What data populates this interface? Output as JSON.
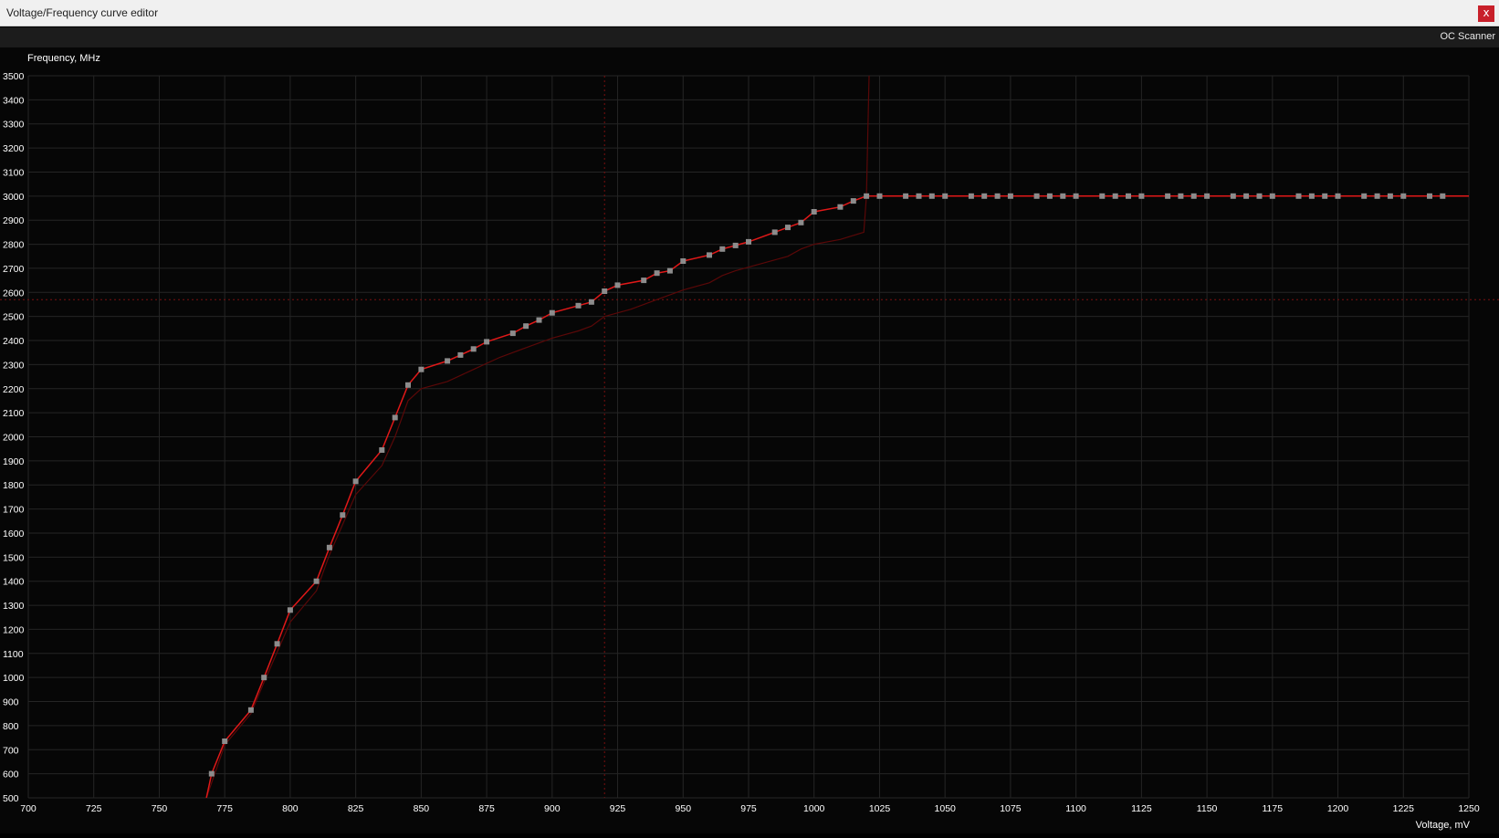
{
  "window": {
    "title": "Voltage/Frequency curve editor",
    "close_label": "x"
  },
  "toolbar": {
    "oc_scanner_label": "OC Scanner"
  },
  "colors": {
    "curve": "#e01818",
    "curve_dim": "#5a0808",
    "point": "#8c8c8c",
    "grid": "#252525",
    "crosshair": "#7a1010",
    "background": "#060606",
    "text": "#ffffff"
  },
  "chart_data": {
    "type": "line",
    "title": "",
    "xlabel": "Voltage, mV",
    "ylabel": "Frequency, MHz",
    "xlim": [
      700,
      1250
    ],
    "ylim": [
      500,
      3500
    ],
    "x_ticks": [
      700,
      725,
      750,
      775,
      800,
      825,
      850,
      875,
      900,
      925,
      950,
      975,
      1000,
      1025,
      1050,
      1075,
      1100,
      1125,
      1150,
      1175,
      1200,
      1225,
      1250
    ],
    "y_ticks": [
      500,
      600,
      700,
      800,
      900,
      1000,
      1100,
      1200,
      1300,
      1400,
      1500,
      1600,
      1700,
      1800,
      1900,
      2000,
      2100,
      2200,
      2300,
      2400,
      2500,
      2600,
      2700,
      2800,
      2900,
      3000,
      3100,
      3200,
      3300,
      3400,
      3500
    ],
    "crosshair": {
      "x": 920,
      "y": 2570
    },
    "series": [
      {
        "role": "edited",
        "x": [
          768,
          770,
          775,
          785,
          790,
          795,
          800,
          810,
          815,
          820,
          825,
          835,
          840,
          845,
          850,
          860,
          865,
          870,
          875,
          885,
          890,
          895,
          900,
          910,
          915,
          920,
          925,
          935,
          940,
          945,
          950,
          960,
          965,
          970,
          975,
          985,
          990,
          995,
          1000,
          1010,
          1015,
          1020,
          1025,
          1035,
          1040,
          1045,
          1050,
          1060,
          1065,
          1070,
          1075,
          1085,
          1090,
          1095,
          1100,
          1110,
          1115,
          1120,
          1125,
          1135,
          1140,
          1145,
          1150,
          1160,
          1165,
          1170,
          1175,
          1185,
          1190,
          1195,
          1200,
          1210,
          1215,
          1220,
          1225,
          1235,
          1240,
          1250
        ],
        "y": [
          500,
          600,
          735,
          865,
          1000,
          1140,
          1280,
          1400,
          1540,
          1675,
          1815,
          1945,
          2080,
          2215,
          2280,
          2315,
          2340,
          2365,
          2395,
          2430,
          2460,
          2485,
          2515,
          2545,
          2560,
          2605,
          2630,
          2650,
          2680,
          2690,
          2730,
          2755,
          2780,
          2795,
          2810,
          2850,
          2870,
          2890,
          2935,
          2955,
          2980,
          3000,
          3000,
          3000,
          3000,
          3000,
          3000,
          3000,
          3000,
          3000,
          3000,
          3000,
          3000,
          3000,
          3000,
          3000,
          3000,
          3000,
          3000,
          3000,
          3000,
          3000,
          3000,
          3000,
          3000,
          3000,
          3000,
          3000,
          3000,
          3000,
          3000,
          3000,
          3000,
          3000,
          3000,
          3000,
          3000,
          3000
        ],
        "points_start_index": 1,
        "points_end_index": 76
      },
      {
        "role": "default",
        "x": [
          768,
          775,
          785,
          790,
          800,
          810,
          815,
          825,
          835,
          840,
          845,
          850,
          860,
          870,
          880,
          890,
          900,
          910,
          915,
          920,
          930,
          940,
          950,
          960,
          965,
          970,
          980,
          990,
          995,
          1000,
          1010,
          1019,
          1020,
          1021
        ],
        "y": [
          500,
          720,
          850,
          980,
          1230,
          1360,
          1510,
          1760,
          1880,
          2000,
          2150,
          2200,
          2230,
          2280,
          2330,
          2370,
          2410,
          2440,
          2460,
          2500,
          2530,
          2570,
          2610,
          2640,
          2670,
          2690,
          2720,
          2750,
          2780,
          2800,
          2820,
          2850,
          3000,
          3500
        ]
      }
    ]
  }
}
